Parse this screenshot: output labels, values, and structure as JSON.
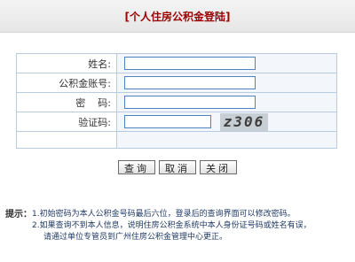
{
  "header": {
    "title": "[个人住房公积金登陆]"
  },
  "form": {
    "name_label": "姓名:",
    "account_label": "公积金账号:",
    "password_label": "密    码:",
    "captcha_label": "验证码:",
    "name_value": "",
    "account_value": "",
    "password_value": "",
    "captcha_value": "",
    "captcha_text": "z306"
  },
  "buttons": {
    "query": "查询",
    "cancel": "取消",
    "close": "关闭"
  },
  "tips": {
    "label": "提示：",
    "line1": "1.初始密码为本人公积金号码最后六位，登录后的查询界面可以修改密码。",
    "line2": "2.如果查询不到本人信息，说明住房公积金系统中本人身份证号码或姓名有误，",
    "line3": "请通过单位专管员到广州住房公积金管理中心更正。"
  }
}
